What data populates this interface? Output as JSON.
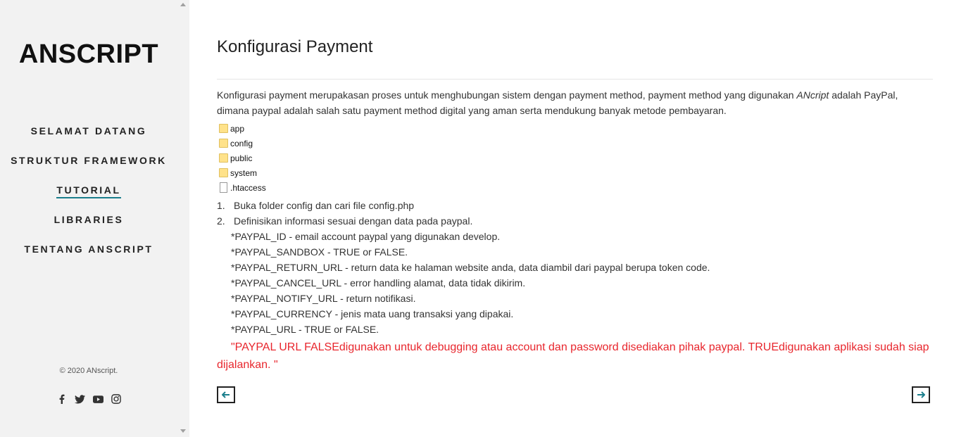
{
  "sidebar": {
    "logo": "ANSCRIPT",
    "nav": [
      {
        "label": "SELAMAT DATANG",
        "active": false
      },
      {
        "label": "STRUKTUR FRAMEWORK",
        "active": false
      },
      {
        "label": "TUTORIAL",
        "active": true
      },
      {
        "label": "LIBRARIES",
        "active": false
      },
      {
        "label": "TENTANG ANSCRIPT",
        "active": false
      }
    ],
    "copyright": "© 2020 ANscript.",
    "social_icons": [
      "facebook-icon",
      "twitter-icon",
      "youtube-icon",
      "instagram-icon"
    ]
  },
  "main": {
    "title": "Konfigurasi Payment",
    "intro": {
      "part1": "Konfigurasi payment merupakasan proses untuk menghubungan sistem dengan payment method, payment method yang digunakan ",
      "brand": "ANcript",
      "part2": " adalah PayPal, dimana paypal adalah salah satu payment method digital yang aman serta mendukung banyak metode pembayaran."
    },
    "files": [
      {
        "type": "folder",
        "name": "app"
      },
      {
        "type": "folder",
        "name": "config"
      },
      {
        "type": "folder",
        "name": "public"
      },
      {
        "type": "folder",
        "name": "system"
      },
      {
        "type": "file",
        "name": ".htaccess"
      }
    ],
    "steps": [
      {
        "num": "1.",
        "text": "Buka folder config dan cari file config.php"
      },
      {
        "num": "2.",
        "text": "Definisikan informasi sesuai dengan data pada paypal."
      }
    ],
    "definitions": [
      "*PAYPAL_ID - email account paypal yang digunakan develop.",
      "*PAYPAL_SANDBOX - TRUE or FALSE.",
      "*PAYPAL_RETURN_URL - return data ke halaman website anda, data diambil dari paypal berupa token code.",
      "*PAYPAL_CANCEL_URL - error handling alamat, data tidak dikirim.",
      "*PAYPAL_NOTIFY_URL - return notifikasi.",
      "*PAYPAL_CURRENCY - jenis mata uang transaksi yang dipakai.",
      "*PAYPAL_URL - TRUE or FALSE."
    ],
    "note": "\"PAYPAL URL FALSEdigunakan untuk debugging atau account dan password disediakan pihak paypal. TRUEdigunakan aplikasi sudah siap dijalankan. \"",
    "prev_icon": "arrow-left-icon",
    "next_icon": "arrow-right-icon"
  },
  "colors": {
    "accent": "#1a7e8c",
    "note": "#e8262d",
    "folder": "#ffe28a"
  }
}
